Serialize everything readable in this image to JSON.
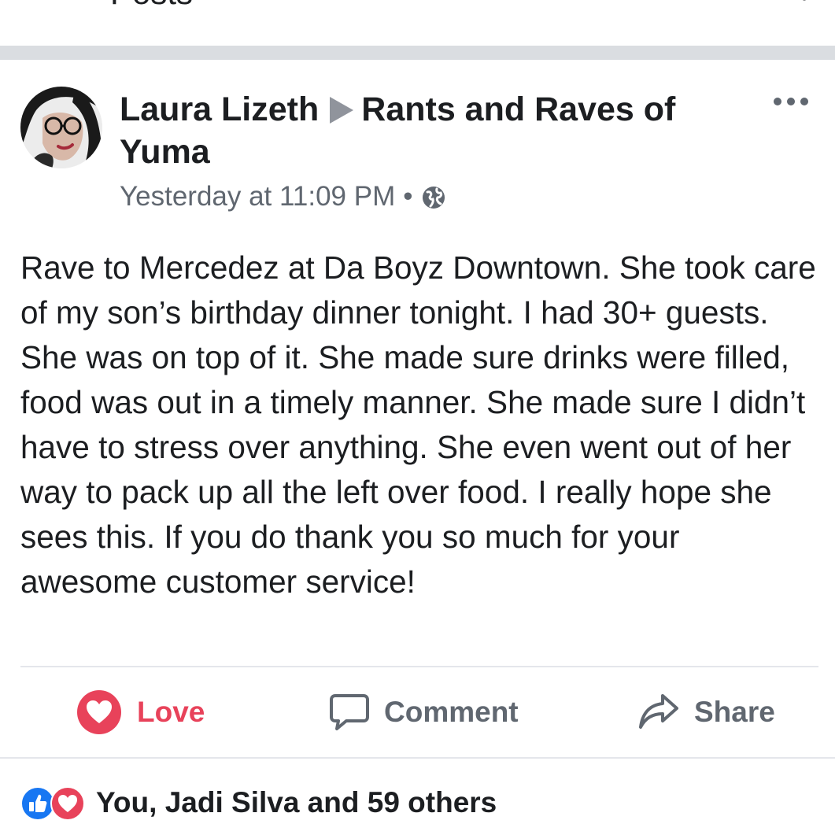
{
  "header": {
    "title": "Posts"
  },
  "post": {
    "author": "Laura Lizeth",
    "group": "Rants and Raves of Yuma",
    "timestamp": "Yesterday at 11:09 PM",
    "separator": "•",
    "privacy_icon": "globe-icon",
    "body": "Rave to Mercedez at Da Boyz Downtown. She took care of my son’s birthday dinner tonight. I had 30+ guests. She was on top of it.  She made sure drinks were filled, food was out in a timely manner. She made sure I didn’t have to stress over anything. She even went out of her way to pack up all the left over food. I really hope she sees this. If you do thank you so much for your awesome customer service!"
  },
  "actions": {
    "love_label": "Love",
    "comment_label": "Comment",
    "share_label": "Share"
  },
  "reactions": {
    "summary": "You, Jadi Silva and 59 others",
    "icons": [
      "like-icon",
      "love-icon"
    ]
  },
  "colors": {
    "love": "#e8425a",
    "like": "#1877f2",
    "secondary_text": "#606770",
    "divider": "#dadde1"
  }
}
